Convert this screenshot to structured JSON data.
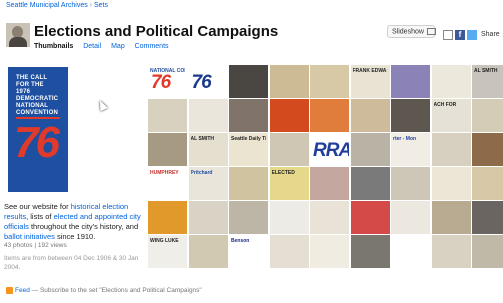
{
  "breadcrumb": {
    "owner": "Seattle Municipal Archives",
    "separator": "›",
    "section": "Sets"
  },
  "set": {
    "title": "Elections and Political Campaigns"
  },
  "tabs": [
    {
      "label": "Thumbnails",
      "active": true
    },
    {
      "label": "Detail",
      "active": false
    },
    {
      "label": "Map",
      "active": false
    },
    {
      "label": "Comments",
      "active": false
    }
  ],
  "toolbar": {
    "slideshow_label": "Slideshow",
    "share_label": "Share",
    "facebook_glyph": "f"
  },
  "cover": {
    "lines": [
      "THE CALL",
      "FOR THE",
      "1976",
      "DEMOCRATIC",
      "NATIONAL",
      "CONVENTION"
    ],
    "number": "76",
    "colors": {
      "background": "#1f4fa0",
      "accent": "#e23a2a"
    }
  },
  "description": {
    "prefix": "See our website for ",
    "link1": "historical election results",
    "mid1": ", lists of ",
    "link2": "elected and appointed city officials",
    "mid2": " throughout the city's history, and ",
    "link3": "ballot initiatives",
    "suffix": " since 1910."
  },
  "stats": "43 photos | 192 views",
  "date_range": "Items are from between 04 Dec 1906 & 30 Jan 2004.",
  "feed": {
    "label": "Feed",
    "text": "— Subscribe to the set \"Elections and Political Campaigns\""
  },
  "thumbnails": [
    {
      "bg": "#ffffff",
      "fg": "#1f4fa0",
      "text": "NATIONAL CONVENTION",
      "big": "76",
      "big_color": "#e23a2a"
    },
    {
      "bg": "#ffffff",
      "fg": "#1a3a8a",
      "text": "",
      "big": "76",
      "big_color": "#1a3a8a"
    },
    {
      "bg": "#4a4742",
      "fg": "#ddd",
      "text": ""
    },
    {
      "bg": "#cdbb95",
      "fg": "#333",
      "text": ""
    },
    {
      "bg": "#d8c9a6",
      "fg": "#333",
      "text": ""
    },
    {
      "bg": "#e9e3d4",
      "fg": "#222",
      "text": "FRANK EDWA FOR MAYOR"
    },
    {
      "bg": "#8b82b8",
      "fg": "#fff",
      "text": ""
    },
    {
      "bg": "#ede8dc",
      "fg": "#222",
      "text": ""
    },
    {
      "bg": "#c9c4bb",
      "fg": "#222",
      "text": "AL SMITH"
    },
    {
      "bg": "#d9d1c0",
      "fg": "#222",
      "text": ""
    },
    {
      "bg": "#eae6dc",
      "fg": "#222",
      "text": ""
    },
    {
      "bg": "#7f736a",
      "fg": "#eee",
      "text": ""
    },
    {
      "bg": "#d34a1e",
      "fg": "#fff",
      "text": ""
    },
    {
      "bg": "#e07c3c",
      "fg": "#fff",
      "text": ""
    },
    {
      "bg": "#cdbb9c",
      "fg": "#333",
      "text": ""
    },
    {
      "bg": "#5d5750",
      "fg": "#eee",
      "text": ""
    },
    {
      "bg": "#e6e1d6",
      "fg": "#222",
      "text": "ACH FOR"
    },
    {
      "bg": "#d5ccb7",
      "fg": "#333",
      "text": ""
    },
    {
      "bg": "#a79a82",
      "fg": "#222",
      "text": ""
    },
    {
      "bg": "#e5dfcf",
      "fg": "#222",
      "text": "AL SMITH"
    },
    {
      "bg": "#ebe4d1",
      "fg": "#222",
      "text": "Seattle Daily Times"
    },
    {
      "bg": "#cfc6b3",
      "fg": "#222",
      "text": ""
    },
    {
      "bg": "#ffffff",
      "fg": "#1f3f9a",
      "text": "",
      "big": "RRA",
      "big_color": "#1f3f9a"
    },
    {
      "bg": "#b9b3a6",
      "fg": "#222",
      "text": ""
    },
    {
      "bg": "#f1ede4",
      "fg": "#1f3f9a",
      "text": "rter - Mon"
    },
    {
      "bg": "#d7d0c1",
      "fg": "#222",
      "text": ""
    },
    {
      "bg": "#8d6a4a",
      "fg": "#fff",
      "text": ""
    },
    {
      "bg": "#ffffff",
      "fg": "#c0302a",
      "text": "HUMPHREY"
    },
    {
      "bg": "#e9e5da",
      "fg": "#1f4fa0",
      "text": "Pritchard"
    },
    {
      "bg": "#cfc3a0",
      "fg": "#222",
      "text": ""
    },
    {
      "bg": "#e6d88a",
      "fg": "#222",
      "text": "ELECTED"
    },
    {
      "bg": "#c4a8a0",
      "fg": "#222",
      "text": ""
    },
    {
      "bg": "#7a7a7a",
      "fg": "#fff",
      "text": ""
    },
    {
      "bg": "#cec7b8",
      "fg": "#222",
      "text": ""
    },
    {
      "bg": "#ece6d7",
      "fg": "#222",
      "text": ""
    },
    {
      "bg": "#d7c8a8",
      "fg": "#222",
      "text": ""
    },
    {
      "bg": "#e0992a",
      "fg": "#fff",
      "text": ""
    },
    {
      "bg": "#d9d3c6",
      "fg": "#222",
      "text": ""
    },
    {
      "bg": "#bdb5a6",
      "fg": "#222",
      "text": ""
    },
    {
      "bg": "#ecebe6",
      "fg": "#222",
      "text": ""
    },
    {
      "bg": "#e8e3d6",
      "fg": "#222",
      "text": ""
    },
    {
      "bg": "#d34a48",
      "fg": "#fff",
      "text": ""
    },
    {
      "bg": "#ece8df",
      "fg": "#222",
      "text": ""
    },
    {
      "bg": "#b9ab92",
      "fg": "#222",
      "text": ""
    },
    {
      "bg": "#6a6560",
      "fg": "#fff",
      "text": ""
    },
    {
      "bg": "#f0eee9",
      "fg": "#222",
      "text": "WING LUKE"
    },
    {
      "bg": "#d2c9b2",
      "fg": "#222",
      "text": ""
    },
    {
      "bg": "#ffffff",
      "fg": "#1a2a8a",
      "text": "Benson"
    },
    {
      "bg": "#e4dfd2",
      "fg": "#222",
      "text": ""
    },
    {
      "bg": "#f0ece2",
      "fg": "#222",
      "text": ""
    },
    {
      "bg": "#7a7670",
      "fg": "#fff",
      "text": ""
    },
    {
      "bg": "#ffffff",
      "fg": "#1f3f9a",
      "text": ""
    },
    {
      "bg": "#d9d2c2",
      "fg": "#222",
      "text": ""
    },
    {
      "bg": "#c1b9a8",
      "fg": "#222",
      "text": ""
    }
  ]
}
